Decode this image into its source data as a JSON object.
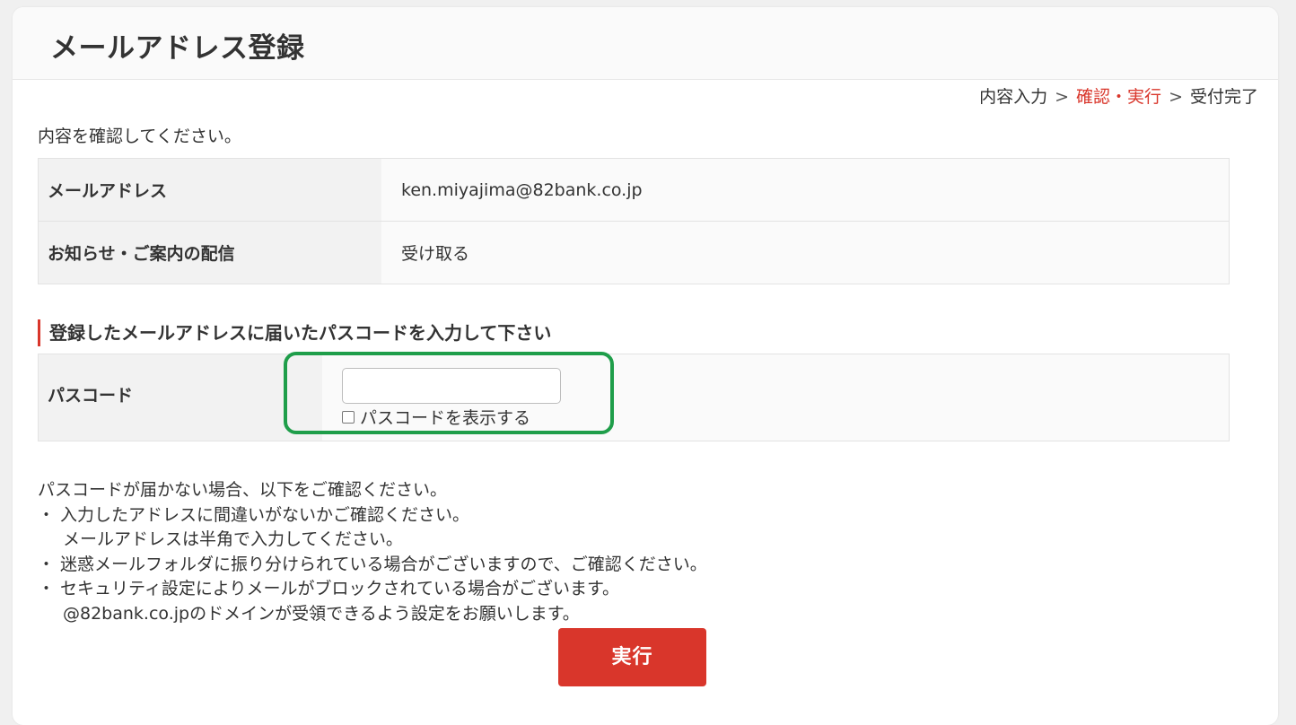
{
  "header": {
    "title": "メールアドレス登録"
  },
  "steps": {
    "step1": "内容入力",
    "separator": ">",
    "step2": "確認・実行",
    "step3": "受付完了"
  },
  "instruction": "内容を確認してください。",
  "confirm_table": {
    "rows": [
      {
        "label": "メールアドレス",
        "value": "ken.miyajima@82bank.co.jp"
      },
      {
        "label": "お知らせ・ご案内の配信",
        "value": "受け取る"
      }
    ]
  },
  "passcode_section": {
    "heading": "登録したメールアドレスに届いたパスコードを入力して下さい",
    "label": "パスコード",
    "input_value": "",
    "show_checkbox_label": "パスコードを表示する",
    "show_checked": false
  },
  "notes": {
    "intro": "パスコードが届かない場合、以下をご確認ください。",
    "lines": [
      "・ 入力したアドレスに間違いがないかご確認ください。",
      "メールアドレスは半角で入力してください。",
      "・ 迷惑メールフォルダに振り分けられている場合がございますので、ご確認ください。",
      "・ セキュリティ設定によりメールがブロックされている場合がございます。",
      "@82bank.co.jpのドメインが受領できるよう設定をお願いします。"
    ]
  },
  "actions": {
    "execute_label": "実行"
  },
  "colors": {
    "accent": "#d9362b",
    "highlight": "#1f9e4a"
  }
}
